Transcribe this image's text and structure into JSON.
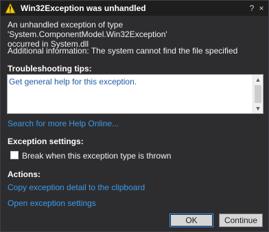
{
  "titlebar": {
    "icon": "warning-icon",
    "title": "Win32Exception was unhandled",
    "help_glyph": "?",
    "close_glyph": "×"
  },
  "message": {
    "line1": "An unhandled exception of type 'System.ComponentModel.Win32Exception'",
    "line2": "occurred in System.dll",
    "info": "Additional information: The system cannot find the file specified"
  },
  "troubleshooting": {
    "title": "Troubleshooting tips:",
    "tips": [
      "Get general help for this exception."
    ],
    "scroll_up_glyph": "▲",
    "scroll_down_glyph": "▼"
  },
  "help_online_link": "Search for more Help Online...",
  "exception_settings": {
    "title": "Exception settings:",
    "checkbox_label": "Break when this exception type is thrown",
    "checked": false
  },
  "actions": {
    "title": "Actions:",
    "copy_link": "Copy exception detail to the clipboard",
    "open_link": "Open exception settings"
  },
  "buttons": {
    "ok": "OK",
    "continue": "Continue"
  },
  "colors": {
    "background": "#2d2d30",
    "titlebar": "#1e1e1e",
    "link": "#3d9bea",
    "warning": "#ffcc00"
  }
}
